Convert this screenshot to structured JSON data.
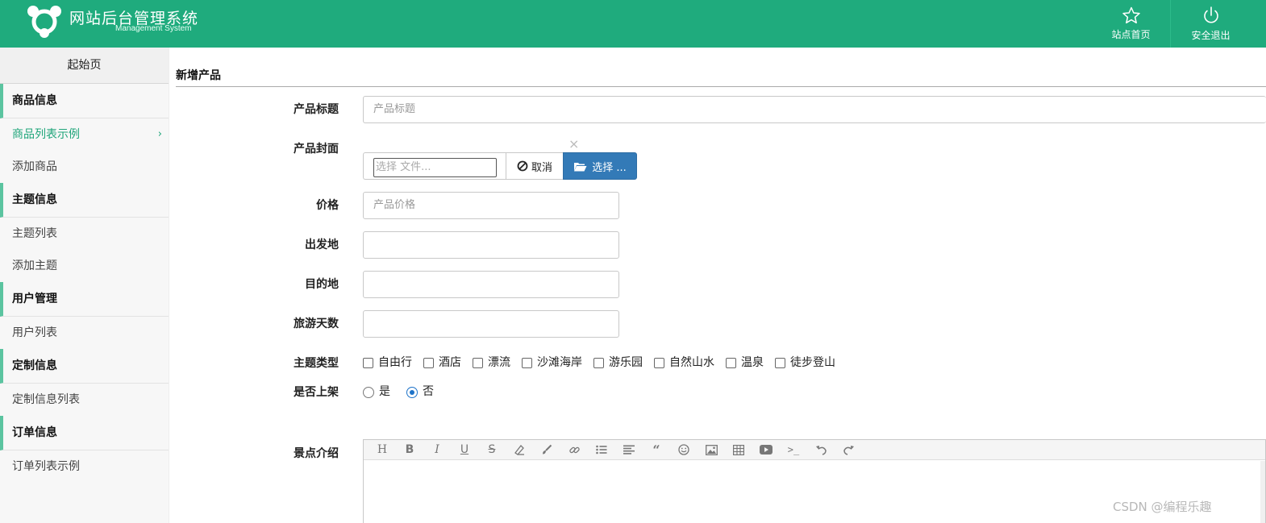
{
  "header": {
    "title": "网站后台管理系统",
    "subtitle": "Management System",
    "nav_home": "站点首页",
    "nav_logout": "安全退出",
    "icons": {
      "home": "star-icon",
      "logout": "power-icon"
    },
    "bg_color": "#1fab7d"
  },
  "sidebar": {
    "start": "起始页",
    "groups": [
      {
        "label": "商品信息",
        "items": [
          {
            "label": "商品列表示例"
          },
          {
            "label": "添加商品"
          }
        ]
      },
      {
        "label": "主题信息",
        "items": [
          {
            "label": "主题列表"
          },
          {
            "label": "添加主题"
          }
        ]
      },
      {
        "label": "用户管理",
        "items": [
          {
            "label": "用户列表"
          }
        ]
      },
      {
        "label": "定制信息",
        "items": [
          {
            "label": "定制信息列表"
          }
        ]
      },
      {
        "label": "订单信息",
        "items": [
          {
            "label": "订单列表示例"
          }
        ]
      }
    ],
    "active_color": "#1fa57a"
  },
  "form": {
    "page_title": "新增产品",
    "title_label": "产品标题",
    "title_placeholder": "产品标题",
    "cover_label": "产品封面",
    "cover_caption": "选择 文件...",
    "cancel_label": "取消",
    "select_label": "选择 ...",
    "close_mark": "×",
    "price_label": "价格",
    "price_placeholder": "产品价格",
    "departure_label": "出发地",
    "destination_label": "目的地",
    "days_label": "旅游天数",
    "theme_label": "主题类型",
    "themes": [
      "自由行",
      "酒店",
      "漂流",
      "沙滩海岸",
      "游乐园",
      "自然山水",
      "温泉",
      "徒步登山"
    ],
    "shelf_label": "是否上架",
    "shelf_yes": "是",
    "shelf_no": "否",
    "shelf_selected": "否",
    "intro_label": "景点介绍",
    "editor_tools": [
      "H",
      "B",
      "I",
      "U",
      "S",
      "eraser-icon",
      "brush-icon",
      "link-icon",
      "list-icon",
      "align-icon",
      "quote-icon",
      "smile-icon",
      "image-icon",
      "table-icon",
      "video-icon",
      "terminal-icon",
      "undo-icon",
      "redo-icon"
    ]
  },
  "watermark": "CSDN @编程乐趣"
}
